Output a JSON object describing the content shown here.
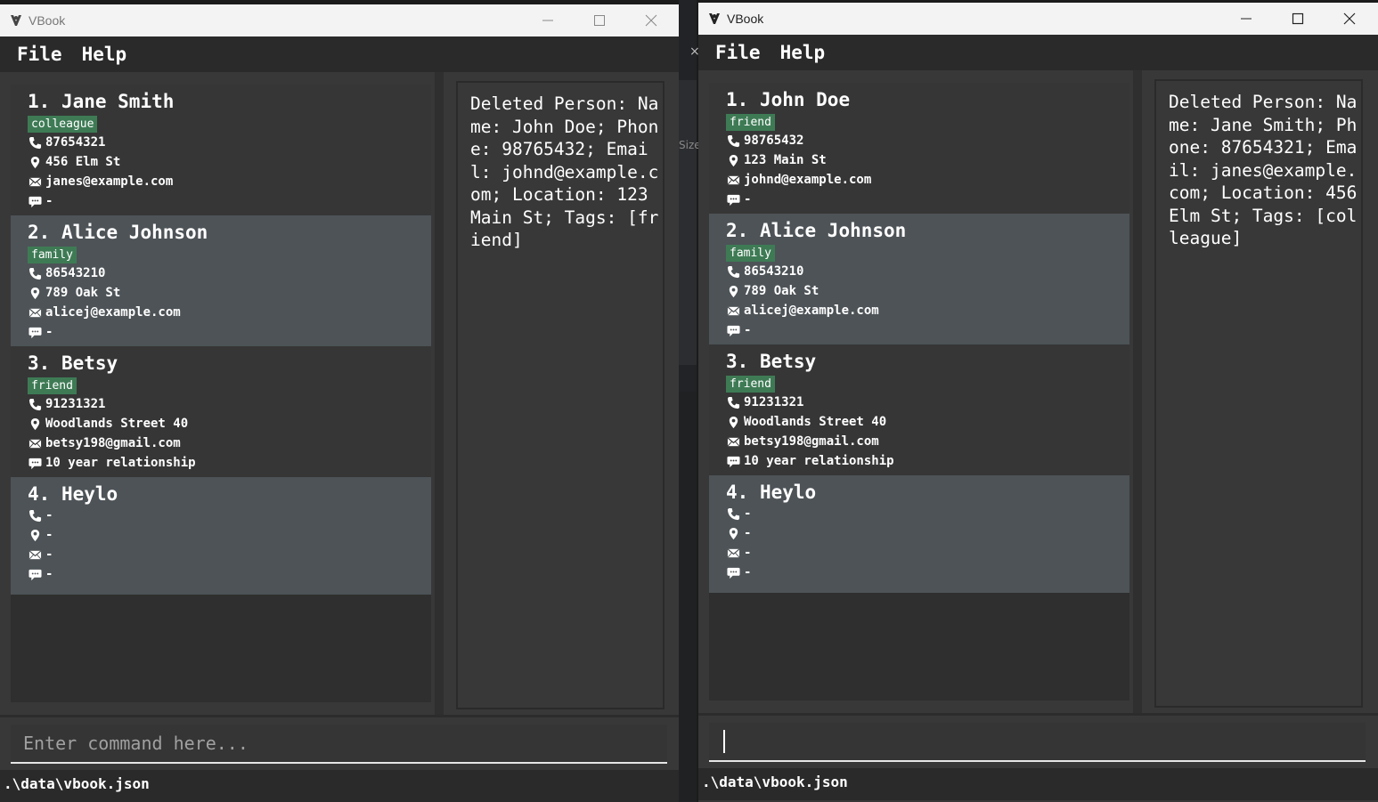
{
  "windows": [
    {
      "title": "VBook",
      "menu": [
        "File",
        "Help"
      ],
      "persons": [
        {
          "index": "1.",
          "name": "Jane Smith",
          "tag": "colleague",
          "phone": "87654321",
          "address": "456 Elm St",
          "email": "janes@example.com",
          "remark": "-"
        },
        {
          "index": "2.",
          "name": "Alice Johnson",
          "tag": "family",
          "phone": "86543210",
          "address": "789 Oak St",
          "email": "alicej@example.com",
          "remark": "-"
        },
        {
          "index": "3.",
          "name": "Betsy",
          "tag": "friend",
          "phone": "91231321",
          "address": "Woodlands Street 40",
          "email": "betsy198@gmail.com",
          "remark": "10 year relationship"
        },
        {
          "index": "4.",
          "name": "Heylo",
          "tag": "",
          "phone": "-",
          "address": "-",
          "email": "-",
          "remark": "-"
        }
      ],
      "result": "Deleted Person: Name: John Doe; Phone: 98765432; Email: johnd@example.com; Location: 123 Main St; Tags: [friend]",
      "command": {
        "value": "",
        "placeholder": "Enter command here..."
      },
      "status": ".\\data\\vbook.json"
    },
    {
      "title": "VBook",
      "menu": [
        "File",
        "Help"
      ],
      "persons": [
        {
          "index": "1.",
          "name": "John Doe",
          "tag": "friend",
          "phone": "98765432",
          "address": "123 Main St",
          "email": "johnd@example.com",
          "remark": "-"
        },
        {
          "index": "2.",
          "name": "Alice Johnson",
          "tag": "family",
          "phone": "86543210",
          "address": "789 Oak St",
          "email": "alicej@example.com",
          "remark": "-"
        },
        {
          "index": "3.",
          "name": "Betsy",
          "tag": "friend",
          "phone": "91231321",
          "address": "Woodlands Street 40",
          "email": "betsy198@gmail.com",
          "remark": "10 year relationship"
        },
        {
          "index": "4.",
          "name": "Heylo",
          "tag": "",
          "phone": "-",
          "address": "-",
          "email": "-",
          "remark": "-"
        }
      ],
      "result": "Deleted Person: Name: Jane Smith; Phone: 87654321; Email: janes@example.com; Location: 456 Elm St; Tags: [colleague]",
      "command": {
        "value": "",
        "placeholder": ""
      },
      "status": ".\\data\\vbook.json"
    }
  ],
  "background": {
    "gap_glyph": "×",
    "gap_text": "Size"
  },
  "colors": {
    "tag": "#3e7b55",
    "card_alt": "#4d5357",
    "card": "#363636",
    "panel": "#383838"
  }
}
